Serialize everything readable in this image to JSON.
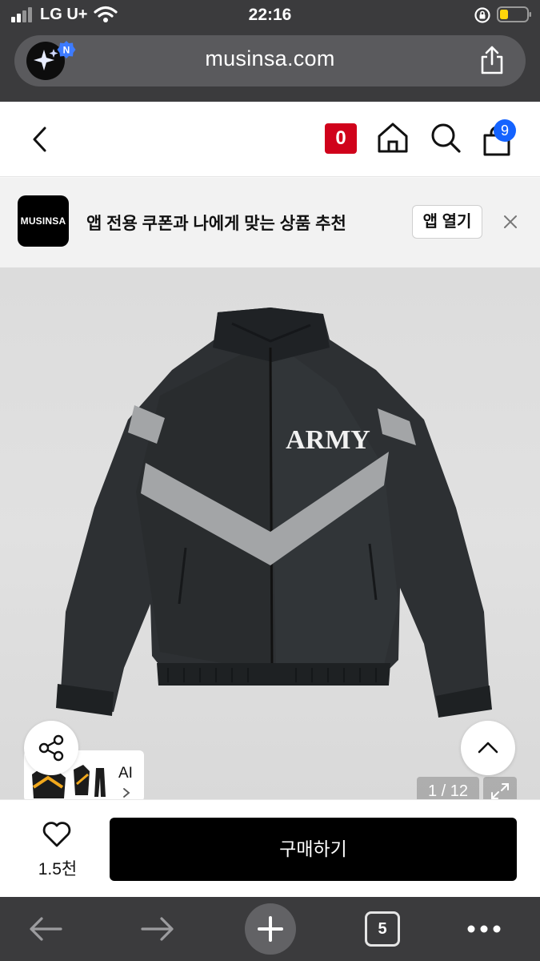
{
  "status_bar": {
    "carrier": "LG U+",
    "time": "22:16"
  },
  "address_bar": {
    "url": "musinsa.com",
    "badge": "N"
  },
  "header": {
    "cart_badge": "0",
    "bag_count": "9"
  },
  "app_banner": {
    "logo_text": "MUSINSA",
    "message": "앱 전용 쿠폰과 나에게 맞는 상품 추천",
    "open_button": "앱 열기"
  },
  "product_image": {
    "print_text": "ARMY",
    "ai_label": "AI",
    "page_counter": "1 / 12",
    "current_page": 1,
    "total_pages": 12
  },
  "purchase": {
    "like_count": "1.5천",
    "buy_label": "구매하기"
  },
  "browser_toolbar": {
    "tab_count": "5"
  },
  "colors": {
    "browser_chrome": "#3b3b3d",
    "badge_red": "#d0021b",
    "bag_count_blue": "#1463ff",
    "buy_button": "#000000"
  }
}
